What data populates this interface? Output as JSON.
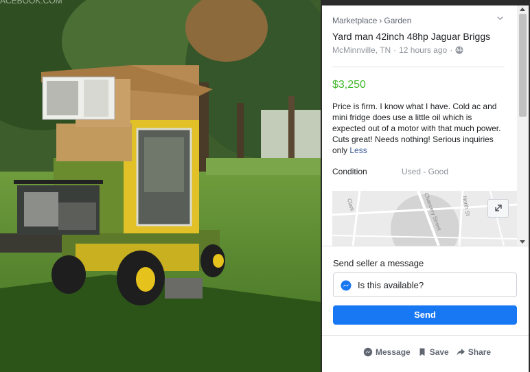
{
  "photo": {
    "watermark": "ACEBOOK.COM"
  },
  "listing": {
    "breadcrumb": [
      "Marketplace",
      "Garden"
    ],
    "breadcrumb_separator": "›",
    "title": "Yard man 42inch 48hp Jaguar Briggs",
    "location": "McMinnville, TN",
    "meta_separator": "·",
    "posted": "12 hours ago",
    "price": "$3,250",
    "description": "Price is firm. I know what I have. Cold ac and mini fridge does use a little oil which is expected out of a motor with that much power. Cuts great! Needs nothing! Serious inquiries only",
    "less_link": "Less",
    "condition_label": "Condition",
    "condition_value": "Used - Good"
  },
  "map": {
    "street_labels": [
      "Clark",
      "Chancery Street",
      "North St"
    ]
  },
  "messaging": {
    "label": "Send seller a message",
    "input_value": "Is this available?",
    "send_label": "Send"
  },
  "footer": {
    "message_label": "Message",
    "save_label": "Save",
    "share_label": "Share"
  },
  "colors": {
    "price": "#42b72a",
    "send_button": "#1877f2",
    "link": "#385898"
  }
}
